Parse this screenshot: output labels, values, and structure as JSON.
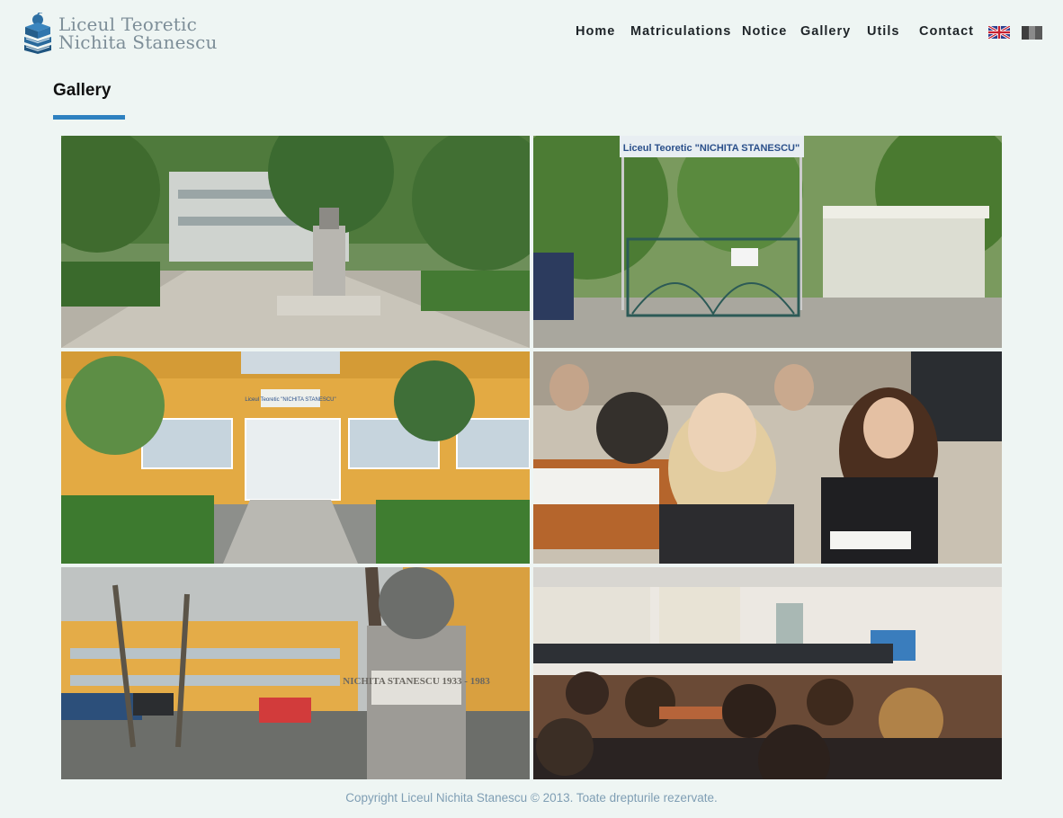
{
  "logo": {
    "line1": "Liceul Teoretic",
    "line2": "Nichita Stanescu"
  },
  "nav": {
    "items": [
      {
        "label": "Home"
      },
      {
        "label": "Matriculations"
      },
      {
        "label": "Notice"
      },
      {
        "label": "Gallery"
      },
      {
        "label": "Utils"
      },
      {
        "label": "Contact"
      }
    ],
    "languages": [
      "english-flag-icon",
      "romanian-flag-icon"
    ]
  },
  "page": {
    "title": "Gallery"
  },
  "gallery": {
    "photos": [
      {
        "subject": "school-courtyard-monument-photo",
        "sign": ""
      },
      {
        "subject": "school-entrance-gate-photo",
        "sign": "Liceul Teoretic \"NICHITA STANESCU\""
      },
      {
        "subject": "school-building-entrance-photo",
        "sign": "Liceul Teoretic \"NICHITA STANESCU\""
      },
      {
        "subject": "students-classroom-photo",
        "sign": ""
      },
      {
        "subject": "nichita-stanescu-bust-photo",
        "sign": "NICHITA STANESCU 1933 - 1983"
      },
      {
        "subject": "computer-lab-students-photo",
        "sign": ""
      }
    ]
  },
  "footer": {
    "copyright": "Copyright Liceul Nichita Stanescu © 2013. Toate drepturile rezervate."
  },
  "colors": {
    "background": "#eef5f3",
    "accent": "#2e81c0",
    "footer_text": "#7f9eb4",
    "logo_text": "#7d8e98"
  }
}
